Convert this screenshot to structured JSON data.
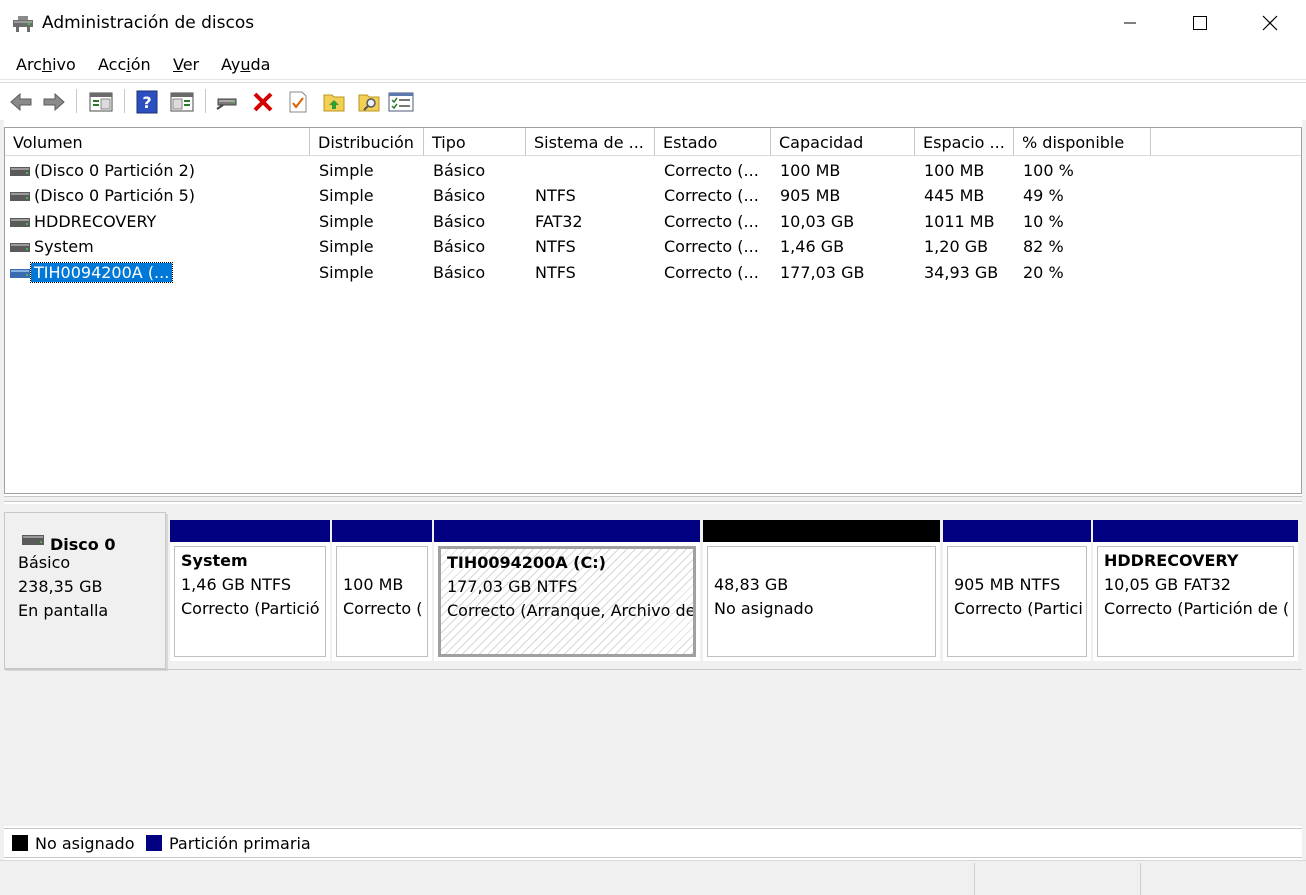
{
  "window": {
    "title": "Administración de discos",
    "controls": {
      "minimize": "minimize-icon",
      "maximize": "maximize-icon",
      "close": "close-icon"
    }
  },
  "menu": {
    "items": [
      {
        "pre": "Arc",
        "accel": "h",
        "post": "ivo"
      },
      {
        "pre": "Acc",
        "accel": "i",
        "post": "ón"
      },
      {
        "pre": "",
        "accel": "V",
        "post": "er"
      },
      {
        "pre": "Ay",
        "accel": "u",
        "post": "da"
      }
    ]
  },
  "toolbar": {
    "buttons": [
      "back-arrow-icon",
      "forward-arrow-icon",
      "show-hide-console-tree-icon",
      "help-icon",
      "properties-pane-icon",
      "connect-drive-icon",
      "delete-icon",
      "check-icon",
      "upload-folder-icon",
      "search-folder-icon",
      "settings-list-icon"
    ]
  },
  "volumes": {
    "columns": [
      "Volumen",
      "Distribución",
      "Tipo",
      "Sistema de ...",
      "Estado",
      "Capacidad",
      "Espacio ...",
      "% disponible"
    ],
    "rows": [
      {
        "volumen": "(Disco 0 Partición 2)",
        "distribucion": "Simple",
        "tipo": "Básico",
        "sistema": "",
        "estado": "Correcto (...",
        "capacidad": "100 MB",
        "espacio": "100 MB",
        "disponible": "100 %"
      },
      {
        "volumen": "(Disco 0 Partición 5)",
        "distribucion": "Simple",
        "tipo": "Básico",
        "sistema": "NTFS",
        "estado": "Correcto (...",
        "capacidad": "905 MB",
        "espacio": "445 MB",
        "disponible": "49 %"
      },
      {
        "volumen": "HDDRECOVERY",
        "distribucion": "Simple",
        "tipo": "Básico",
        "sistema": "FAT32",
        "estado": "Correcto (...",
        "capacidad": "10,03 GB",
        "espacio": "1011 MB",
        "disponible": "10 %"
      },
      {
        "volumen": "System",
        "distribucion": "Simple",
        "tipo": "Básico",
        "sistema": "NTFS",
        "estado": "Correcto (...",
        "capacidad": "1,46 GB",
        "espacio": "1,20 GB",
        "disponible": "82 %"
      },
      {
        "volumen": "TIH0094200A (...",
        "distribucion": "Simple",
        "tipo": "Básico",
        "sistema": "NTFS",
        "estado": "Correcto (...",
        "capacidad": "177,03 GB",
        "espacio": "34,93 GB",
        "disponible": "20 %"
      }
    ],
    "selected_row": 4
  },
  "disk": {
    "name": "Disco 0",
    "type": "Básico",
    "size": "238,35 GB",
    "status": "En pantalla",
    "partitions": [
      {
        "title": "System",
        "line1": "1,46 GB NTFS",
        "line2": "Correcto (Partició",
        "kind": "primary"
      },
      {
        "title": "",
        "line1": "100 MB",
        "line2": "Correcto (",
        "kind": "primary"
      },
      {
        "title": "TIH0094200A  (C:)",
        "line1": "177,03 GB NTFS",
        "line2": "Correcto (Arranque, Archivo de",
        "kind": "primary"
      },
      {
        "title": "",
        "line1": "48,83 GB",
        "line2": "No asignado",
        "kind": "unallocated"
      },
      {
        "title": "",
        "line1": "905 MB NTFS",
        "line2": "Correcto (Partici",
        "kind": "primary"
      },
      {
        "title": "HDDRECOVERY",
        "line1": "10,05 GB FAT32",
        "line2": "Correcto (Partición de (",
        "kind": "primary"
      }
    ]
  },
  "legend": {
    "unallocated": "No asignado",
    "primary": "Partición primaria"
  },
  "colors": {
    "primary": "#000080",
    "unallocated": "#000000",
    "selection": "#0078d7"
  }
}
